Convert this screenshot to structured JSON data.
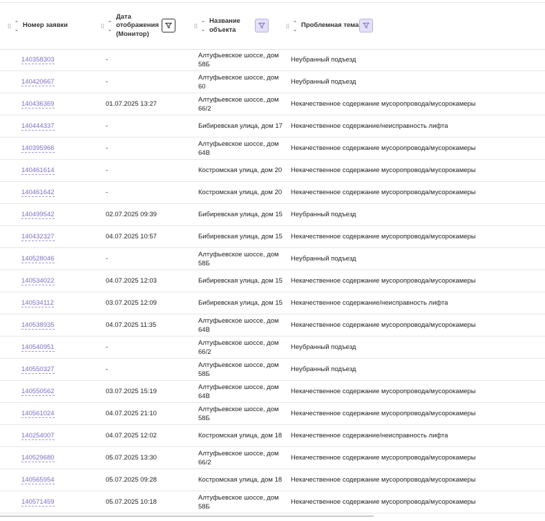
{
  "columns": [
    {
      "label": "Номер заявки"
    },
    {
      "label": "Дата отображения (Монитор)"
    },
    {
      "label": "Название объекта"
    },
    {
      "label": "Проблемная тема"
    }
  ],
  "rows": [
    {
      "id": "140358303",
      "date": "-",
      "object": "Алтуфьевское шоссе, дом 58Б",
      "topic": "Неубранный подъезд"
    },
    {
      "id": "140420667",
      "date": "-",
      "object": "Алтуфьевское шоссе, дом 60",
      "topic": "Неубранный подъезд"
    },
    {
      "id": "140436369",
      "date": "01.07.2025 13:27",
      "object": "Алтуфьевское шоссе, дом 66/2",
      "topic": "Некачественное содержание мусоропровода/мусорокамеры"
    },
    {
      "id": "140444337",
      "date": "-",
      "object": "Бибиревская улица, дом 17",
      "topic": "Некачественное содержание/неисправность лифта"
    },
    {
      "id": "140395966",
      "date": "-",
      "object": "Алтуфьевское шоссе, дом 64В",
      "topic": "Некачественное содержание мусоропровода/мусорокамеры"
    },
    {
      "id": "140461614",
      "date": "-",
      "object": "Костромская улица, дом 20",
      "topic": "Некачественное содержание мусоропровода/мусорокамеры"
    },
    {
      "id": "140461642",
      "date": "-",
      "object": "Костромская улица, дом 20",
      "topic": "Некачественное содержание мусоропровода/мусорокамеры"
    },
    {
      "id": "140499542",
      "date": "02.07.2025 09:39",
      "object": "Бибиревская улица, дом 15",
      "topic": "Неубранный подъезд"
    },
    {
      "id": "140432327",
      "date": "04.07.2025 10:57",
      "object": "Бибиревская улица, дом 15",
      "topic": "Некачественное содержание мусоропровода/мусорокамеры"
    },
    {
      "id": "140528046",
      "date": "-",
      "object": "Алтуфьевское шоссе, дом 58Б",
      "topic": "Неубранный подъезд"
    },
    {
      "id": "140534022",
      "date": "04.07.2025 12:03",
      "object": "Бибиревская улица, дом 15",
      "topic": "Некачественное содержание мусоропровода/мусорокамеры"
    },
    {
      "id": "140534112",
      "date": "03.07.2025 12:09",
      "object": "Бибиревская улица, дом 15",
      "topic": "Некачественное содержание/неисправность лифта"
    },
    {
      "id": "140538935",
      "date": "04.07.2025 11:35",
      "object": "Алтуфьевское шоссе, дом 64В",
      "topic": "Некачественное содержание мусоропровода/мусорокамеры"
    },
    {
      "id": "140540951",
      "date": "-",
      "object": "Алтуфьевское шоссе, дом 66/2",
      "topic": "Неубранный подъезд"
    },
    {
      "id": "140550327",
      "date": "-",
      "object": "Алтуфьевское шоссе, дом 58Б",
      "topic": "Неубранный подъезд"
    },
    {
      "id": "140550562",
      "date": "03.07.2025 15:19",
      "object": "Алтуфьевское шоссе, дом 64В",
      "topic": "Некачественное содержание мусоропровода/мусорокамеры"
    },
    {
      "id": "140561024",
      "date": "04.07.2025 21:10",
      "object": "Алтуфьевское шоссе, дом 58Б",
      "topic": "Некачественное содержание мусоропровода/мусорокамеры"
    },
    {
      "id": "140254007",
      "date": "04.07.2025 12:02",
      "object": "Костромская улица, дом 18",
      "topic": "Некачественное содержание/неисправность лифта"
    },
    {
      "id": "140529680",
      "date": "05.07.2025 13:30",
      "object": "Алтуфьевское шоссе, дом 66/2",
      "topic": "Некачественное содержание мусоропровода/мусорокамеры"
    },
    {
      "id": "140565954",
      "date": "05.07.2025 09:28",
      "object": "Костромская улица, дом 18",
      "topic": "Некачественное содержание мусоропровода/мусорокамеры"
    },
    {
      "id": "140571459",
      "date": "05.07.2025 10:18",
      "object": "Алтуфьевское шоссе, дом 58Б",
      "topic": "Некачественное содержание мусоропровода/мусорокамеры"
    }
  ],
  "icons": {
    "sort": "sort-icon",
    "filter": "filter-icon",
    "drag": "drag-handle-icon"
  },
  "colors": {
    "link": "#7b6fc7",
    "filter_active_bg": "#e4e0f7",
    "filter_active_border": "#b9b0e0",
    "divider": "#e6e6e6"
  }
}
